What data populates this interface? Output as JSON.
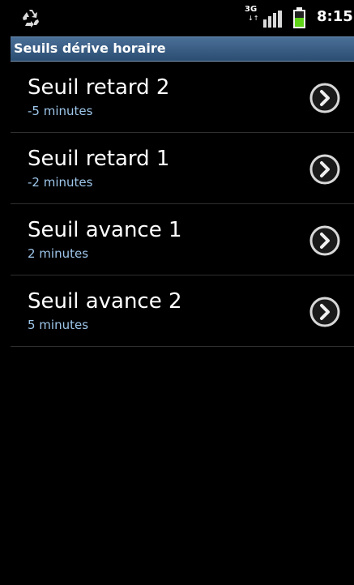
{
  "status_bar": {
    "network_type": "3G",
    "network_arrows": "↓↑",
    "time": "8:15"
  },
  "header": {
    "title": "Seuils dérive horaire"
  },
  "items": [
    {
      "title": "Seuil retard 2",
      "summary": "-5 minutes"
    },
    {
      "title": "Seuil retard 1",
      "summary": "-2 minutes"
    },
    {
      "title": "Seuil avance 1",
      "summary": "2 minutes"
    },
    {
      "title": "Seuil avance 2",
      "summary": "5 minutes"
    }
  ],
  "colors": {
    "background": "#000000",
    "title_bar": "#3a5f86",
    "title_text": "#ffffff",
    "item_title": "#ffffff",
    "item_summary": "#9ec6ea",
    "divider": "#2f2f2f",
    "battery_green": "#5ed318"
  },
  "icons": {
    "app_status": "recycle-icon",
    "signal": "signal-strength-icon",
    "battery": "battery-icon",
    "item_action": "chevron-right-icon"
  }
}
